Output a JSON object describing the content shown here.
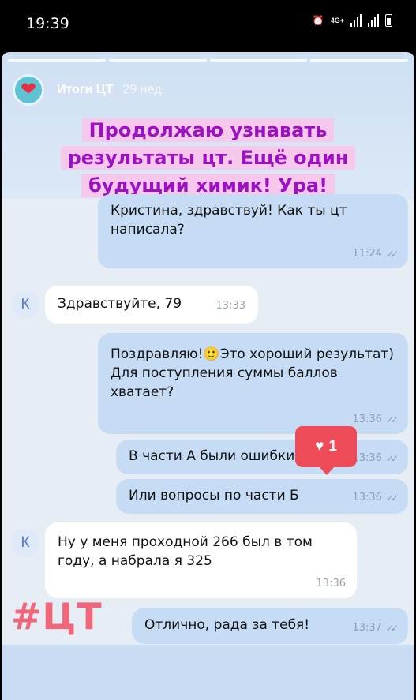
{
  "status_bar": {
    "time": "19:39",
    "network": "4G+"
  },
  "story": {
    "author": "Итоги ЦТ",
    "ago": "29 нед.",
    "caption_lines": [
      "Продолжаю узнавать",
      "результаты цт. Ещё один",
      "будущий химик! Ура!"
    ],
    "hashtag": "#ЦТ",
    "like_count": "1"
  },
  "contact_initial": "К",
  "messages": [
    {
      "dir": "out",
      "text": "Кристина, здравствуй! Как ты цт написала?",
      "time": "11:24"
    },
    {
      "dir": "in",
      "text": "Здравствуйте, 79",
      "time": "13:33"
    },
    {
      "dir": "out",
      "text": "Поздравляю!🙂Это хороший результат) Для поступления суммы баллов хватает?",
      "time": "13:36"
    },
    {
      "dir": "out",
      "text": "В части А были ошибки?",
      "time": "13:36"
    },
    {
      "dir": "out",
      "text": "Или вопросы по части Б",
      "time": "13:36"
    },
    {
      "dir": "in",
      "text": "Ну у меня проходной 266 был в том году, а набрала я 325",
      "time": "13:36"
    },
    {
      "dir": "out",
      "text": "Отлично, рада за тебя!",
      "time": "13:37"
    }
  ]
}
